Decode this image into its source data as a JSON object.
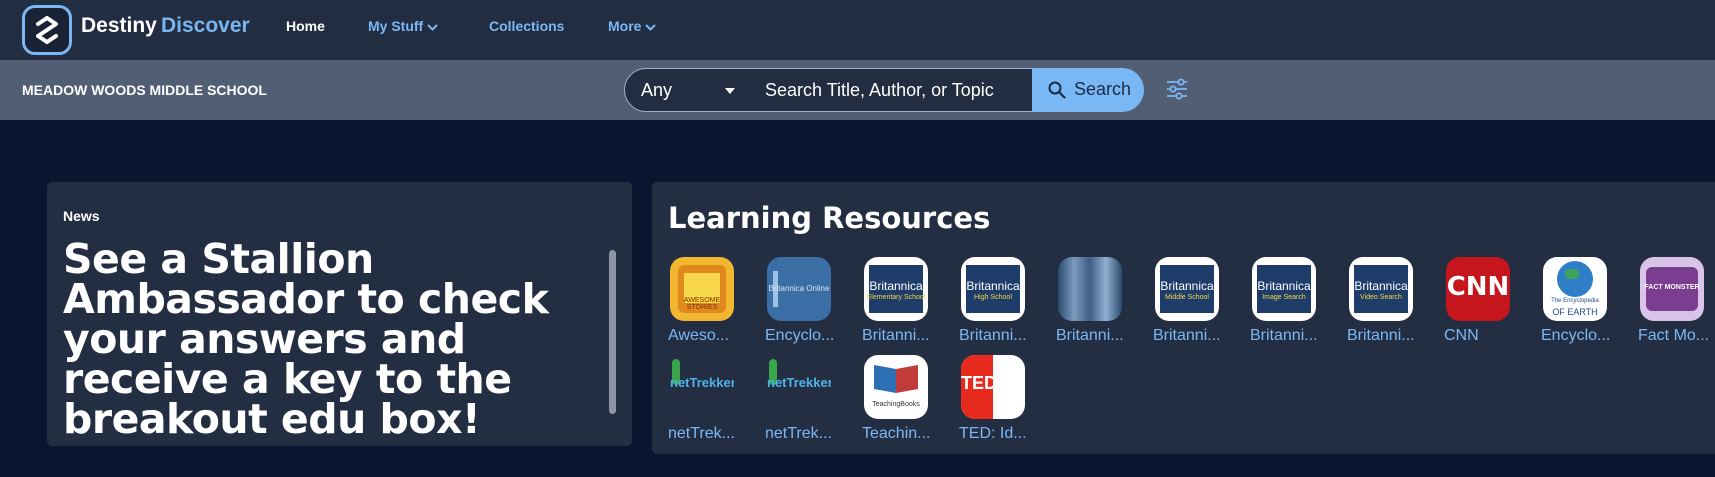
{
  "brand": {
    "name": "Destiny",
    "product": "Discover"
  },
  "nav": [
    {
      "label": "Home",
      "active": true,
      "dropdown": false
    },
    {
      "label": "My Stuff",
      "active": false,
      "dropdown": true
    },
    {
      "label": "Collections",
      "active": false,
      "dropdown": false
    },
    {
      "label": "More",
      "active": false,
      "dropdown": true
    }
  ],
  "school": "MEADOW WOODS MIDDLE SCHOOL",
  "search": {
    "scope_value": "Any",
    "placeholder": "Search Title, Author, or Topic",
    "button_label": "Search"
  },
  "news": {
    "label": "News",
    "headline": "See a Stallion Ambassador to check your answers and receive a key to the breakout edu box!"
  },
  "learning_resources": {
    "title": "Learning Resources",
    "items": [
      {
        "label": "Aweso...",
        "icon": "awesome-stories-icon",
        "icon_text": "AWESOME STORIES"
      },
      {
        "label": "Encyclo...",
        "icon": "britannica-online-icon",
        "icon_text": "Britannica Online"
      },
      {
        "label": "Britanni...",
        "icon": "britannica-elementary-icon",
        "icon_text": "Britannica",
        "icon_sub": "Elementary School"
      },
      {
        "label": "Britanni...",
        "icon": "britannica-high-icon",
        "icon_text": "Britannica",
        "icon_sub": "High School"
      },
      {
        "label": "Britanni...",
        "icon": "britannica-blurred-icon"
      },
      {
        "label": "Britanni...",
        "icon": "britannica-middle-icon",
        "icon_text": "Britannica",
        "icon_sub": "Middle School"
      },
      {
        "label": "Britanni...",
        "icon": "britannica-image-icon",
        "icon_text": "Britannica",
        "icon_sub": "Image Search"
      },
      {
        "label": "Britanni...",
        "icon": "britannica-video-icon",
        "icon_text": "Britannica",
        "icon_sub": "Video Search"
      },
      {
        "label": "CNN",
        "icon": "cnn-icon",
        "icon_text": "CNN"
      },
      {
        "label": "Encyclo...",
        "icon": "encyclopedia-of-earth-icon",
        "icon_text": "The Encyclopedia",
        "icon_sub": "OF EARTH"
      },
      {
        "label": "Fact Mo...",
        "icon": "fact-monster-icon",
        "icon_text": "FACT MONSTER"
      },
      {
        "label": "netTrek...",
        "icon": "nettrekker-icon",
        "icon_text": "netTrekker"
      },
      {
        "label": "netTrek...",
        "icon": "nettrekker-icon-2",
        "icon_text": "netTrekker"
      },
      {
        "label": "Teachin...",
        "icon": "teachingbooks-icon",
        "icon_text": "TeachingBooks"
      },
      {
        "label": "TED: Id...",
        "icon": "ted-icon",
        "icon_text": "TED"
      }
    ]
  },
  "colors": {
    "accent": "#7ab8f5",
    "nav_bg": "#232d41",
    "subbar_bg": "#525e73",
    "page_bg": "#0b1530",
    "card_bg": "#242e42"
  }
}
